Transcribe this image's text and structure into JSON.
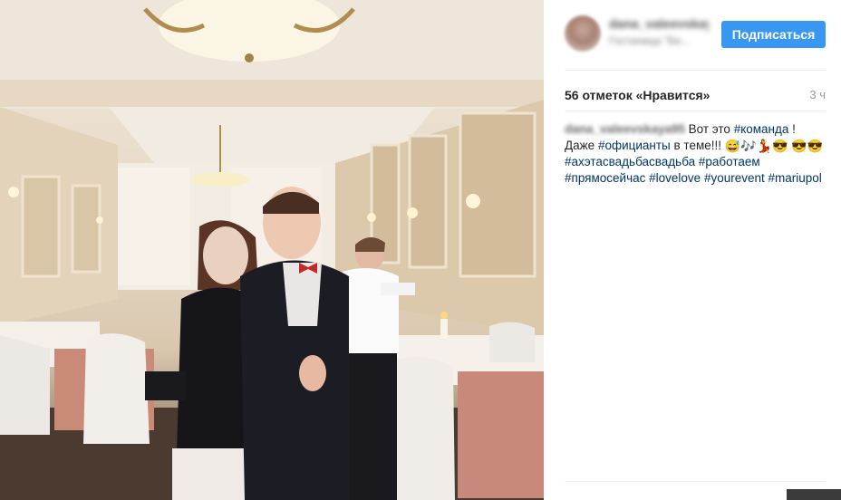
{
  "post": {
    "photo_alt": "",
    "header": {
      "username": "dana_valeevskaya95",
      "location": "Гостиница \"Бе...",
      "follow_label": "Подписаться"
    },
    "likes_text": "56 отметок «Нравится»",
    "time_ago": "3 ч",
    "caption": {
      "author": "dana_valeevskaya95",
      "text_1": "Вот это ",
      "tag_1": "#команда",
      "text_2": " ! Даже ",
      "tag_2": "#официанты",
      "text_3": " в теме!!! ",
      "emojis_1": "😅🎶💃😎",
      "emojis_2": "😎😎",
      "tags_rest": [
        "#ахэтасвадьбасвадьба",
        "#работаем",
        "#прямосейчас",
        "#lovelove",
        "#yourevent",
        "#mariupol"
      ]
    }
  },
  "colors": {
    "follow_button": "#3897f0",
    "hashtag": "#003569",
    "text": "#262626",
    "muted": "#999999"
  }
}
